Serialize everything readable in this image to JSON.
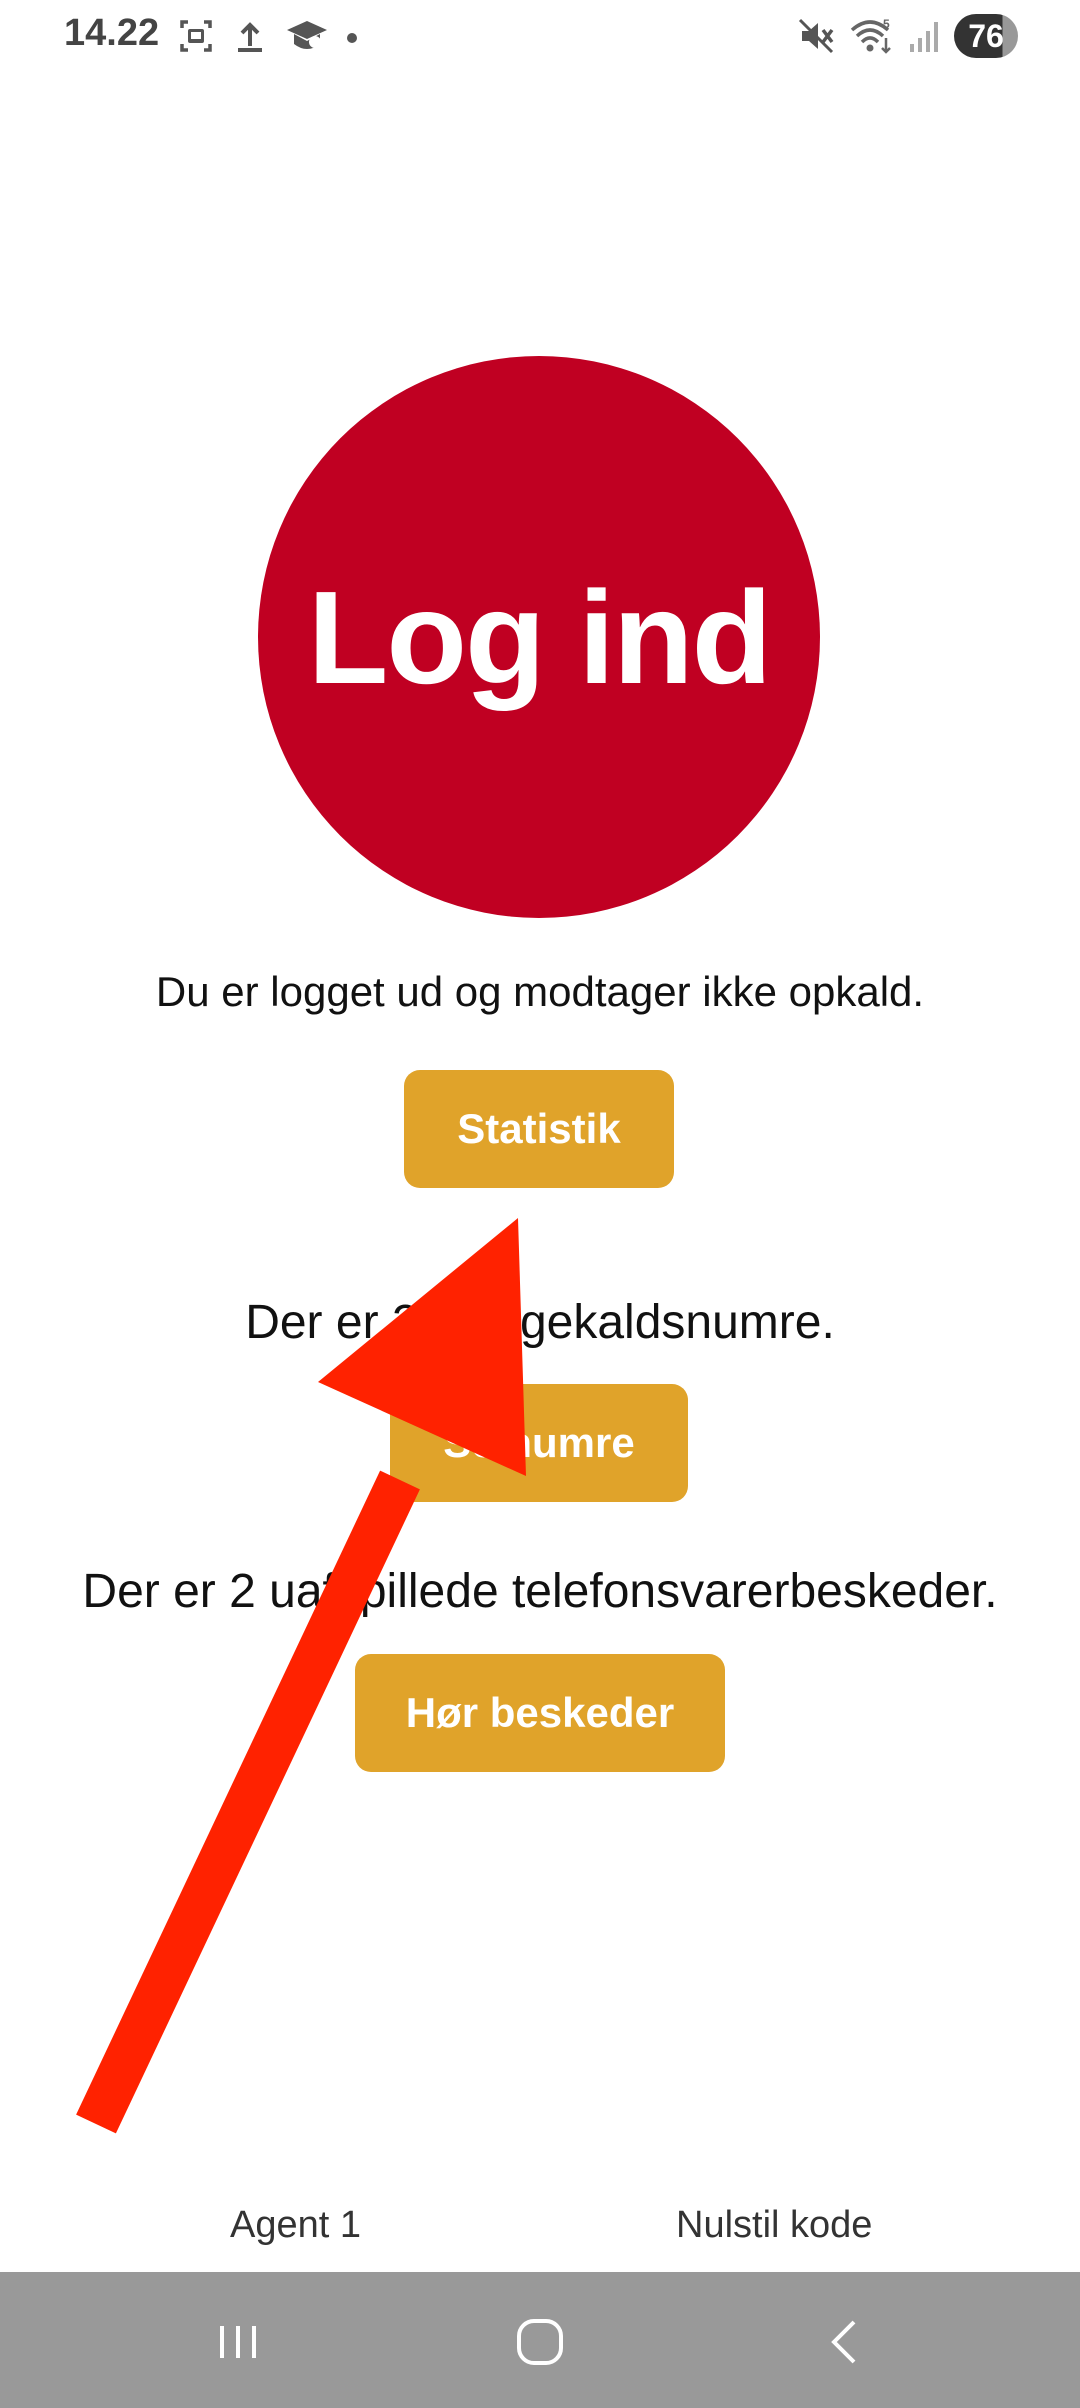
{
  "status_bar": {
    "time": "14.22",
    "battery": "76",
    "left_icons": [
      "screenshot-icon",
      "upload-icon",
      "graduation-cap-icon",
      "dot-icon"
    ],
    "right_icons": [
      "mute-icon",
      "wifi-icon",
      "signal-icon"
    ]
  },
  "main": {
    "login_button": "Log ind",
    "status_message": "Du er logget ud og modtager ikke opkald.",
    "statistics_button": "Statistik",
    "numbers_message": "Der er 2 tilbagekaldsnumre.",
    "numbers_button": "Se numre",
    "voicemail_message": "Der er 2 uafspillede telefonsvarerbeskeder.",
    "voicemail_button": "Hør beskeder"
  },
  "footer": {
    "agent_link": "Agent 1",
    "reset_link": "Nulstil kode"
  },
  "colors": {
    "login_circle": "#c00022",
    "action_button": "#e0a32a",
    "arrow": "#ff2200",
    "nav_bar": "#999999"
  },
  "nav": {
    "icons": [
      "recent-apps-icon",
      "home-icon",
      "back-icon"
    ]
  }
}
